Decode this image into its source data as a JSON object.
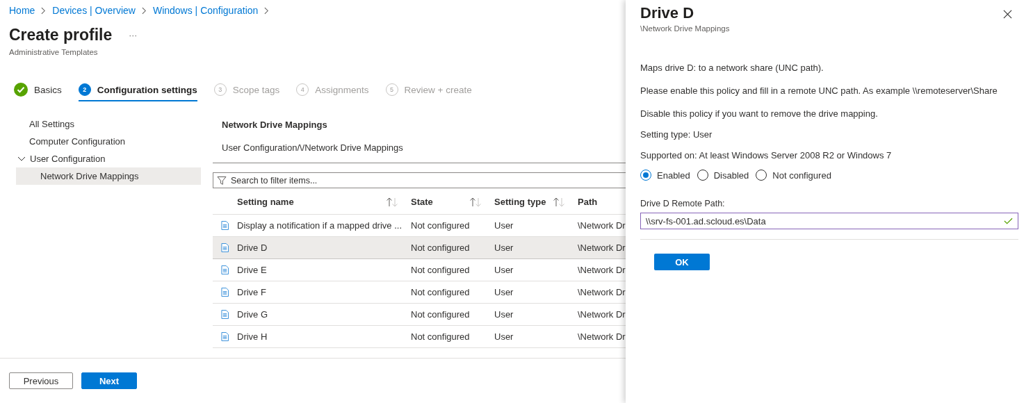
{
  "breadcrumb": [
    "Home",
    "Devices | Overview",
    "Windows | Configuration"
  ],
  "page": {
    "title": "Create profile",
    "more": "···",
    "subtitle": "Administrative Templates"
  },
  "steps": [
    {
      "label": "Basics",
      "completed": true,
      "selected": false
    },
    {
      "number": "2",
      "label": "Configuration settings",
      "completed": false,
      "selected": true
    },
    {
      "number": "3",
      "label": "Scope tags",
      "completed": false,
      "selected": false
    },
    {
      "number": "4",
      "label": "Assignments",
      "completed": false,
      "selected": false
    },
    {
      "number": "5",
      "label": "Review + create",
      "completed": false,
      "selected": false
    }
  ],
  "tree": [
    {
      "label": "All Settings",
      "selected": false
    },
    {
      "label": "Computer Configuration",
      "selected": false
    },
    {
      "label": "User Configuration",
      "selected": false,
      "expanded": true,
      "children": [
        {
          "label": "Network Drive Mappings",
          "selected": true
        }
      ]
    }
  ],
  "section": {
    "title": "Network Drive Mappings",
    "path": "User Configuration/\\/Network Drive Mappings"
  },
  "search": {
    "placeholder": "Search to filter items..."
  },
  "table": {
    "columns": [
      {
        "label": "Setting name",
        "sortable": true
      },
      {
        "label": "State",
        "sortable": true
      },
      {
        "label": "Setting type",
        "sortable": true
      },
      {
        "label": "Path",
        "sortable": false
      }
    ],
    "rows": [
      {
        "name": "Display a notification if a mapped drive ...",
        "state": "Not configured",
        "type": "User",
        "path": "\\Network Dr",
        "selected": false
      },
      {
        "name": "Drive D",
        "state": "Not configured",
        "type": "User",
        "path": "\\Network Dr",
        "selected": true
      },
      {
        "name": "Drive E",
        "state": "Not configured",
        "type": "User",
        "path": "\\Network Dr",
        "selected": false
      },
      {
        "name": "Drive F",
        "state": "Not configured",
        "type": "User",
        "path": "\\Network Dr",
        "selected": false
      },
      {
        "name": "Drive G",
        "state": "Not configured",
        "type": "User",
        "path": "\\Network Dr",
        "selected": false
      },
      {
        "name": "Drive H",
        "state": "Not configured",
        "type": "User",
        "path": "\\Network Dr",
        "selected": false
      }
    ]
  },
  "footer": {
    "buttons": [
      {
        "label": "Previous",
        "kind": "secondary"
      },
      {
        "label": "Next",
        "kind": "primary"
      }
    ]
  },
  "panel": {
    "title": "Drive D",
    "subtitle": "\\Network Drive Mappings",
    "paragraphs": [
      "Maps drive D: to a network share (UNC path).",
      "Please enable this policy and fill in a remote UNC path. As example \\\\remoteserver\\Share",
      "Disable this policy if you want to remove the drive mapping."
    ],
    "details": [
      "Setting type: User",
      "Supported on: At least Windows Server 2008 R2 or Windows 7"
    ],
    "options": [
      {
        "label": "Enabled",
        "selected": true
      },
      {
        "label": "Disabled",
        "selected": false
      },
      {
        "label": "Not configured",
        "selected": false
      }
    ],
    "field": {
      "label": "Drive D Remote Path:",
      "value": "\\\\srv-fs-001.ad.scloud.es\\Data",
      "valid": true
    },
    "button": "OK"
  }
}
